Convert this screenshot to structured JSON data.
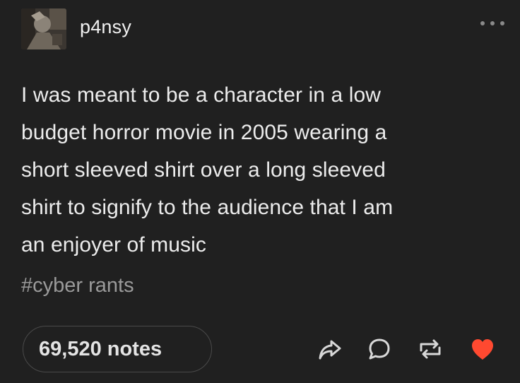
{
  "post": {
    "username": "p4nsy",
    "avatar_icon": "avatar-image",
    "more_icon": "ellipsis-icon",
    "body_lines": [
      "I was meant to be a character in a low",
      "budget horror movie in 2005 wearing a",
      "short sleeved shirt over a long sleeved",
      "shirt to signify to the audience that I am",
      "an enjoyer of music"
    ],
    "tag": "#cyber rants",
    "notes_label": "69,520 notes",
    "actions": {
      "share_icon": "share-icon",
      "reply_icon": "reply-icon",
      "reblog_icon": "reblog-icon",
      "like_icon": "heart-icon"
    },
    "colors": {
      "background": "#202020",
      "text": "#ececec",
      "muted": "#9a9a9a",
      "like_active": "#ff4930"
    }
  }
}
